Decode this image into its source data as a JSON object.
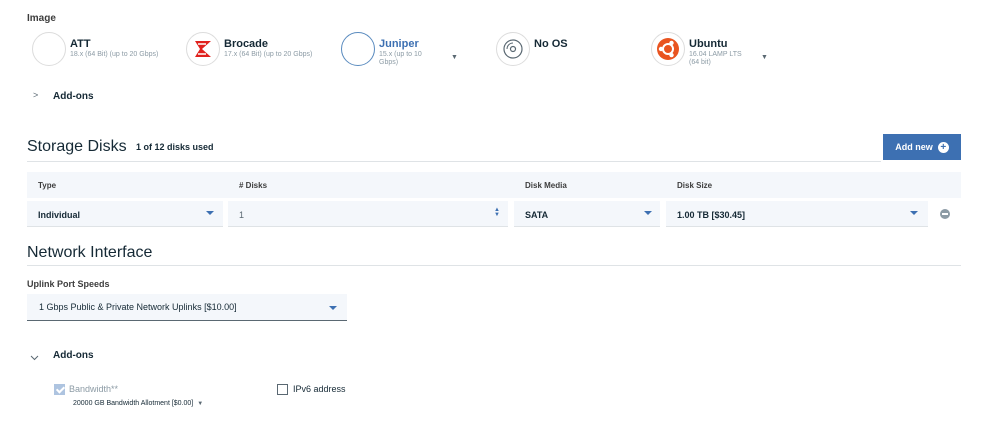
{
  "image_section": {
    "label": "Image",
    "options": [
      {
        "name": "ATT",
        "version": "18.x (64 Bit) (up to 20 Gbps)",
        "icon": "att-logo-icon",
        "selected": false,
        "has_dropdown": false
      },
      {
        "name": "Brocade",
        "version": "17.x (64 Bit) (up to 20 Gbps)",
        "icon": "brocade-logo-icon",
        "selected": false,
        "has_dropdown": false
      },
      {
        "name": "Juniper",
        "version": "15.x (up to 10 Gbps)",
        "icon": "juniper-logo-icon",
        "selected": true,
        "has_dropdown": true
      },
      {
        "name": "No OS",
        "version": "",
        "icon": "disc-icon",
        "selected": false,
        "has_dropdown": false
      },
      {
        "name": "Ubuntu",
        "version": "16.04 LAMP LTS (64 bit)",
        "icon": "ubuntu-logo-icon",
        "selected": false,
        "has_dropdown": true
      }
    ],
    "addons_label": "Add-ons"
  },
  "storage": {
    "title": "Storage Disks",
    "usage": "1 of 12 disks used",
    "add_button": "Add new",
    "columns": [
      "Type",
      "# Disks",
      "Disk Media",
      "Disk Size"
    ],
    "row": {
      "type": "Individual",
      "disks": "1",
      "media": "SATA",
      "size": "1.00 TB [$30.45]"
    }
  },
  "network": {
    "title": "Network Interface",
    "uplink_label": "Uplink Port Speeds",
    "uplink_value": "1 Gbps Public & Private Network Uplinks [$10.00]",
    "addons_label": "Add-ons",
    "bandwidth_label": "Bandwidth**",
    "bandwidth_checked": true,
    "bandwidth_value": "20000 GB Bandwidth Allotment [$0.00]",
    "ipv6_label": "IPv6 address",
    "ipv6_checked": false
  },
  "colors": {
    "accent": "#3d70b2",
    "brocade_red": "#e0211d",
    "ubuntu_orange": "#e95420"
  }
}
